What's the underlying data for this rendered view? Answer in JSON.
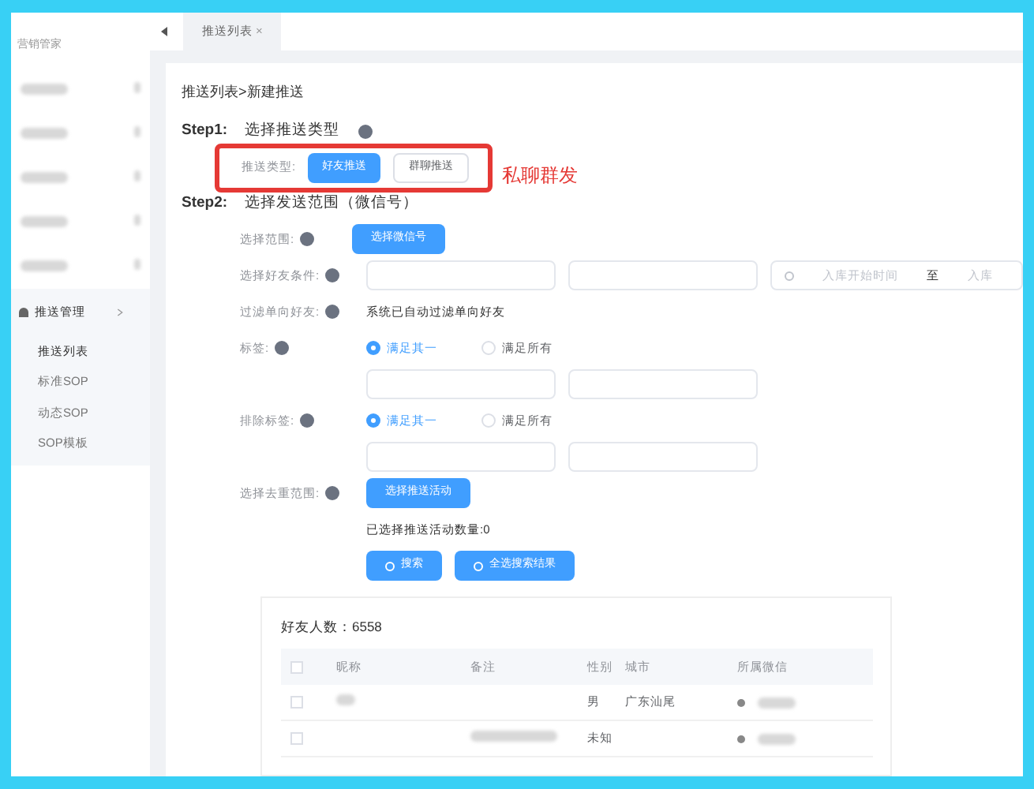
{
  "sidebar": {
    "title": "营销管家",
    "group": {
      "label": "推送管理",
      "expanded": true,
      "children": [
        {
          "label": "推送列表",
          "selected": true
        },
        {
          "label": "标准SOP",
          "selected": false
        },
        {
          "label": "动态SOP",
          "selected": false
        },
        {
          "label": "SOP模板",
          "selected": false
        }
      ]
    }
  },
  "tabs": [
    {
      "label": "推送列表",
      "selected": true,
      "closable": "×"
    }
  ],
  "breadcrumb": "推送列表>新建推送",
  "step1": {
    "step": "Step1:",
    "title": "选择推送类型",
    "type_label": "推送类型:",
    "options": [
      {
        "label": "好友推送",
        "selected": true
      },
      {
        "label": "群聊推送",
        "selected": false
      }
    ],
    "annotation": "私聊群发"
  },
  "step2": {
    "step": "Step2:",
    "title": "选择发送范围（微信号）",
    "range_label": "选择范围:",
    "range_button": "选择微信号",
    "condition_label": "选择好友条件:",
    "date_start": "入库开始时间",
    "date_sep": "至",
    "date_end": "入库",
    "filter_label": "过滤单向好友:",
    "filter_text": "系统已自动过滤单向好友",
    "tag_groups": [
      {
        "label": "标签:",
        "options": [
          {
            "label": "满足其一",
            "selected": true
          },
          {
            "label": "满足所有",
            "selected": false
          }
        ]
      },
      {
        "label": "排除标签:",
        "options": [
          {
            "label": "满足其一",
            "selected": true
          },
          {
            "label": "满足所有",
            "selected": false
          }
        ]
      }
    ],
    "dedupe_label": "选择去重范围:",
    "dedupe_button": "选择推送活动",
    "dedupe_count": "已选择推送活动数量:0",
    "buttons": [
      "搜索",
      "全选搜索结果"
    ]
  },
  "table": {
    "count": "好友人数：6558",
    "all_checked": false,
    "columns": [
      "昵称",
      "备注",
      "性别",
      "城市",
      "所属微信"
    ],
    "rows": [
      {
        "checked": false,
        "gender": "男",
        "city": "广东汕尾"
      },
      {
        "checked": false,
        "gender": "未知",
        "city": ""
      }
    ]
  }
}
